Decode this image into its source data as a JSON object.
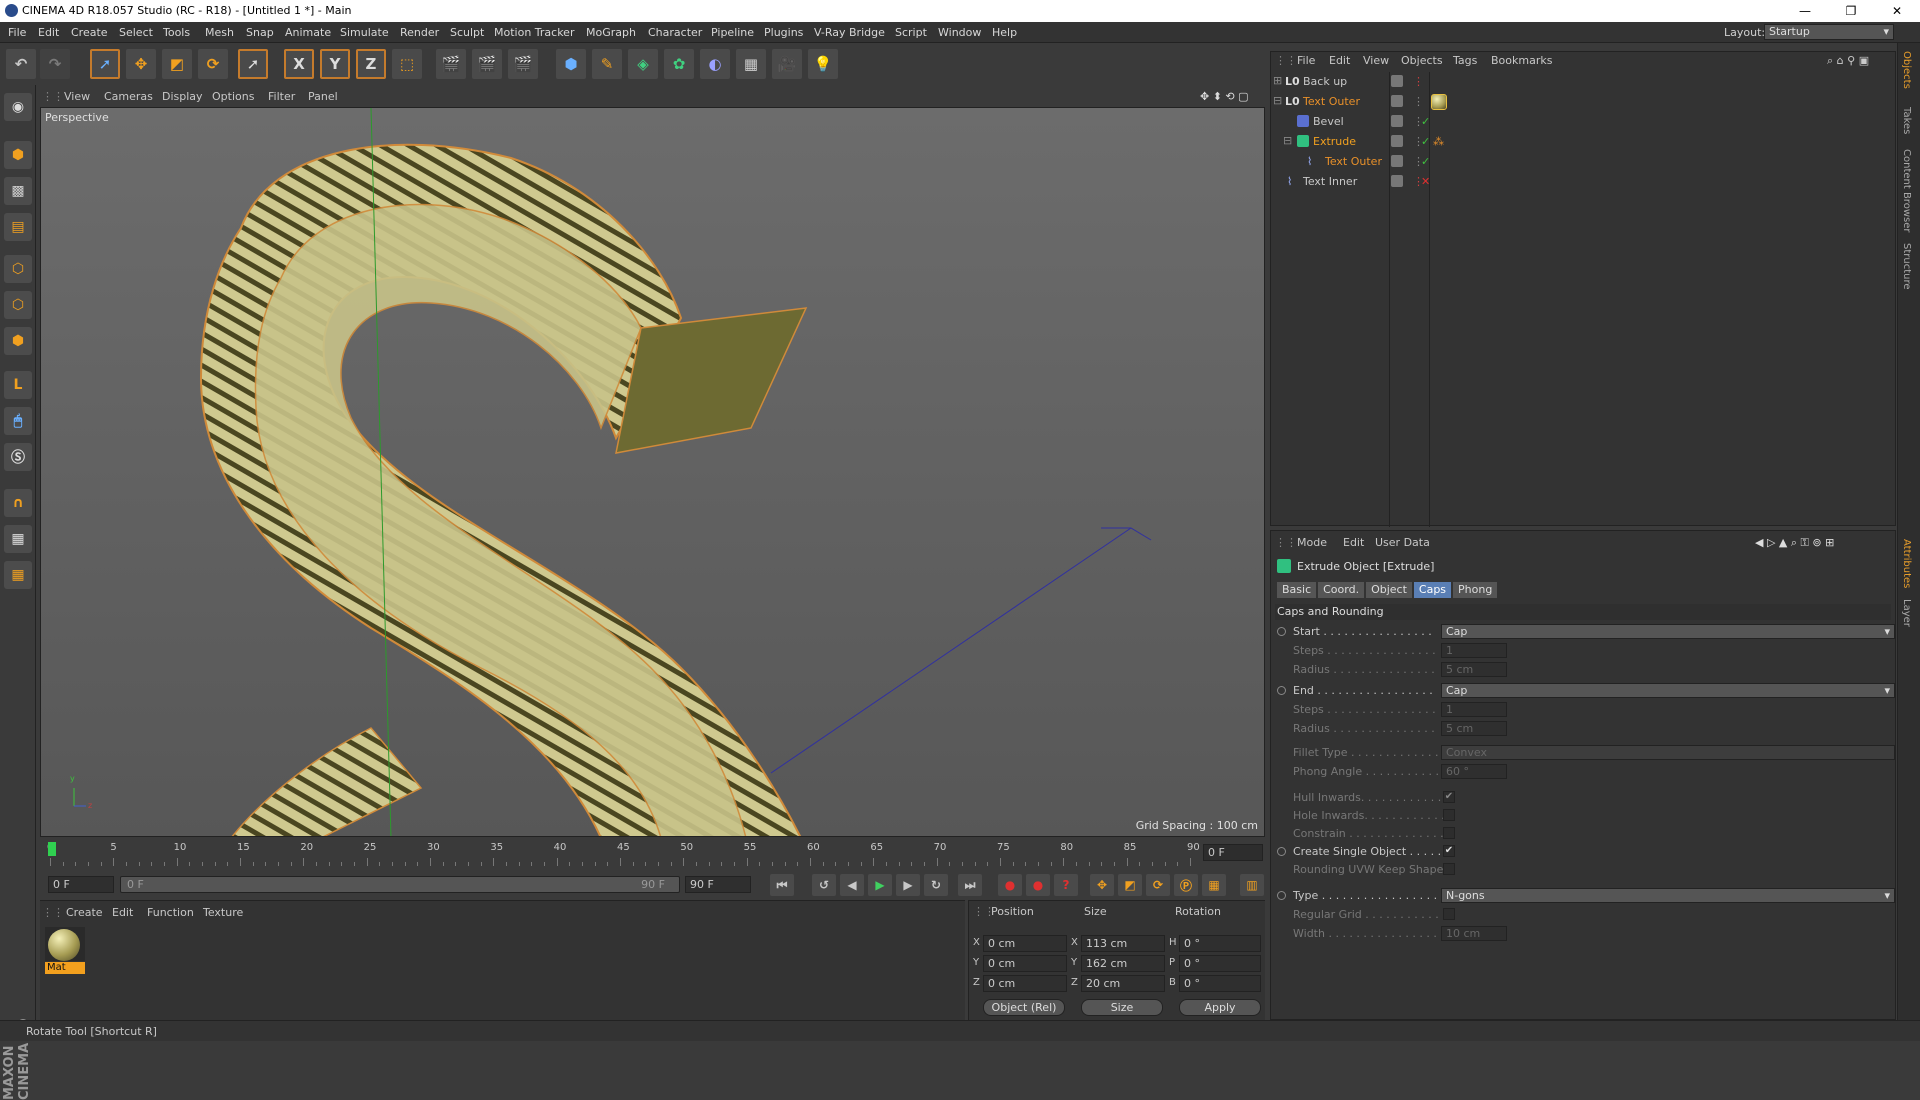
{
  "window": {
    "title": "CINEMA 4D R18.057 Studio (RC - R18) - [Untitled 1 *] - Main",
    "min": "—",
    "max": "❐",
    "close": "✕"
  },
  "menu": [
    "File",
    "Edit",
    "Create",
    "Select",
    "Tools",
    "Mesh",
    "Snap",
    "Animate",
    "Simulate",
    "Render",
    "Sculpt",
    "Motion Tracker",
    "MoGraph",
    "Character",
    "Pipeline",
    "Plugins",
    "V-Ray Bridge",
    "Script",
    "Window",
    "Help"
  ],
  "layout": {
    "label": "Layout:",
    "value": "Startup"
  },
  "toolbar": {
    "x": "X",
    "y": "Y",
    "z": "Z"
  },
  "viewport": {
    "menu": [
      "View",
      "Cameras",
      "Display",
      "Options",
      "Filter",
      "Panel"
    ],
    "label": "Perspective",
    "grid_spacing": "Grid Spacing : 100 cm",
    "axis_y": "y",
    "axis_z": "z"
  },
  "timeline": {
    "ticks": [
      "0",
      "5",
      "10",
      "15",
      "20",
      "25",
      "30",
      "35",
      "40",
      "45",
      "50",
      "55",
      "60",
      "65",
      "70",
      "75",
      "80",
      "85",
      "90"
    ],
    "current_frame": "0 F"
  },
  "transport": {
    "start": "0 F",
    "range_start": "0 F",
    "range_end": "90 F",
    "end": "90 F"
  },
  "material_manager": {
    "menu": [
      "Create",
      "Edit",
      "Function",
      "Texture"
    ],
    "materials": [
      {
        "name": "Mat"
      }
    ]
  },
  "coordinates": {
    "headers": {
      "position": "Position",
      "size": "Size",
      "rotation": "Rotation"
    },
    "rows": [
      {
        "axis": "X",
        "pos": "0 cm",
        "size_axis": "X",
        "size": "113 cm",
        "rot_axis": "H",
        "rot": "0 °"
      },
      {
        "axis": "Y",
        "pos": "0 cm",
        "size_axis": "Y",
        "size": "162 cm",
        "rot_axis": "P",
        "rot": "0 °"
      },
      {
        "axis": "Z",
        "pos": "0 cm",
        "size_axis": "Z",
        "size": "20 cm",
        "rot_axis": "B",
        "rot": "0 °"
      }
    ],
    "mode": "Object (Rel)",
    "size_mode": "Size",
    "apply": "Apply"
  },
  "object_manager": {
    "menu": [
      "File",
      "Edit",
      "View",
      "Objects",
      "Tags",
      "Bookmarks"
    ],
    "objects": [
      {
        "name": "Back up",
        "color": "#c8c8c8"
      },
      {
        "name": "Text Outer",
        "color": "#e8902a"
      },
      {
        "name": "Bevel",
        "color": "#c8c8c8"
      },
      {
        "name": "Extrude",
        "color": "#f0a020"
      },
      {
        "name": "Text Outer",
        "color": "#e8902a"
      },
      {
        "name": "Text Inner",
        "color": "#c8c8c8"
      }
    ]
  },
  "attributes": {
    "menu": [
      "Mode",
      "Edit",
      "User Data"
    ],
    "title": "Extrude Object [Extrude]",
    "tabs": [
      "Basic",
      "Coord.",
      "Object",
      "Caps",
      "Phong"
    ],
    "active_tab": "Caps",
    "section": "Caps and Rounding",
    "rows": {
      "start": {
        "label": "Start . . . . . . . . . . . . . . . .",
        "value": "Cap"
      },
      "steps1": {
        "label": "Steps . . . . . . . . . . . . . . . .",
        "value": "1"
      },
      "radius1": {
        "label": "Radius . . . . . . . . . . . . . . .",
        "value": "5 cm"
      },
      "end": {
        "label": "End . . . . . . . . . . . . . . . . .",
        "value": "Cap"
      },
      "steps2": {
        "label": "Steps . . . . . . . . . . . . . . . .",
        "value": "1"
      },
      "radius2": {
        "label": "Radius . . . . . . . . . . . . . . .",
        "value": "5 cm"
      },
      "fillet": {
        "label": "Fillet Type . . . . . . . . . . . . .",
        "value": "Convex"
      },
      "phong": {
        "label": "Phong Angle . . . . . . . . . . . .",
        "value": "60 °"
      },
      "hull": {
        "label": "Hull Inwards. . . . . . . . . . . . .",
        "value": "✔"
      },
      "hole": {
        "label": "Hole Inwards. . . . . . . . . . . . .",
        "value": ""
      },
      "constrain": {
        "label": "Constrain . . . . . . . . . . . . . .",
        "value": ""
      },
      "single": {
        "label": "Create Single Object . . . . . .",
        "value": "✔"
      },
      "uvw": {
        "label": "Rounding UVW Keep Shape",
        "value": ""
      },
      "type": {
        "label": "Type . . . . . . . . . . . . . . . . .",
        "value": "N-gons"
      },
      "regular": {
        "label": "Regular Grid . . . . . . . . . . . .",
        "value": ""
      },
      "width": {
        "label": "Width . . . . . . . . . . . . . . . .",
        "value": "10 cm"
      }
    }
  },
  "right_tabs": [
    "Objects",
    "Takes",
    "Content Browser",
    "Structure",
    "Attributes",
    "Layer"
  ],
  "status": "Rotate Tool [Shortcut R]",
  "brand": "MAXON CINEMA 4D"
}
